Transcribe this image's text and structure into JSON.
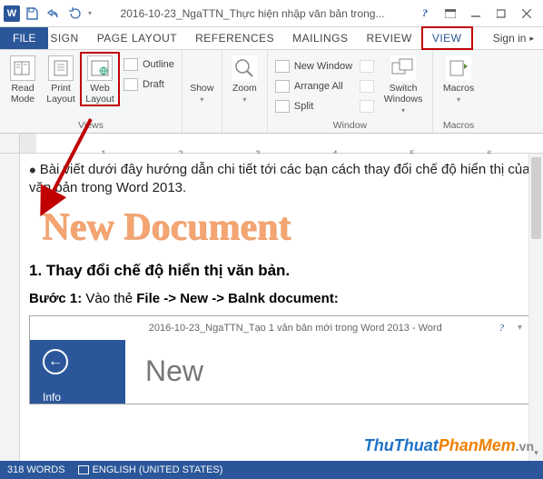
{
  "titlebar": {
    "app_icon_letter": "W",
    "title": "2016-10-23_NgaTTN_Thực hiện nhập văn bản trong..."
  },
  "tabs": {
    "file": "FILE",
    "partial_sign": "SIGN",
    "page_layout": "PAGE LAYOUT",
    "references": "REFERENCES",
    "mailings": "MAILINGS",
    "review": "REVIEW",
    "view": "VIEW",
    "signin": "Sign in"
  },
  "ribbon": {
    "views": {
      "read_mode": "Read Mode",
      "print_layout": "Print Layout",
      "web_layout": "Web Layout",
      "outline": "Outline",
      "draft": "Draft",
      "group": "Views"
    },
    "show": {
      "btn": "Show",
      "group": ""
    },
    "zoom": {
      "btn": "Zoom",
      "group": ""
    },
    "window": {
      "new_window": "New Window",
      "arrange_all": "Arrange All",
      "split": "Split",
      "switch_windows": "Switch Windows",
      "group": "Window"
    },
    "macros": {
      "btn": "Macros",
      "group": "Macros"
    }
  },
  "ruler": {
    "n1": "1",
    "n2": "2",
    "n3": "3",
    "n4": "4",
    "n5": "5",
    "n6": "6"
  },
  "document": {
    "para1": "Bài viết dưới đây hướng dẫn chi tiết tới các bạn cách thay đổi chế độ hiển thị của văn bản trong Word 2013.",
    "big_title": "New Document",
    "h1": "1. Thay đổi chế độ hiển thị văn bản.",
    "step_label": "Bước 1:",
    "step_text": " Vào thẻ ",
    "step_bold": "File -> New -> Balnk document:",
    "inner": {
      "title": "2016-10-23_NgaTTN_Tạo 1 văn bản mới trong Word 2013 - Word",
      "help": "?",
      "info": "Info",
      "new": "New"
    }
  },
  "watermark": {
    "a": "ThuThuat",
    "b": "PhanMem",
    "c": ".vn"
  },
  "status": {
    "words": "318 WORDS",
    "lang": "ENGLISH (UNITED STATES)"
  }
}
